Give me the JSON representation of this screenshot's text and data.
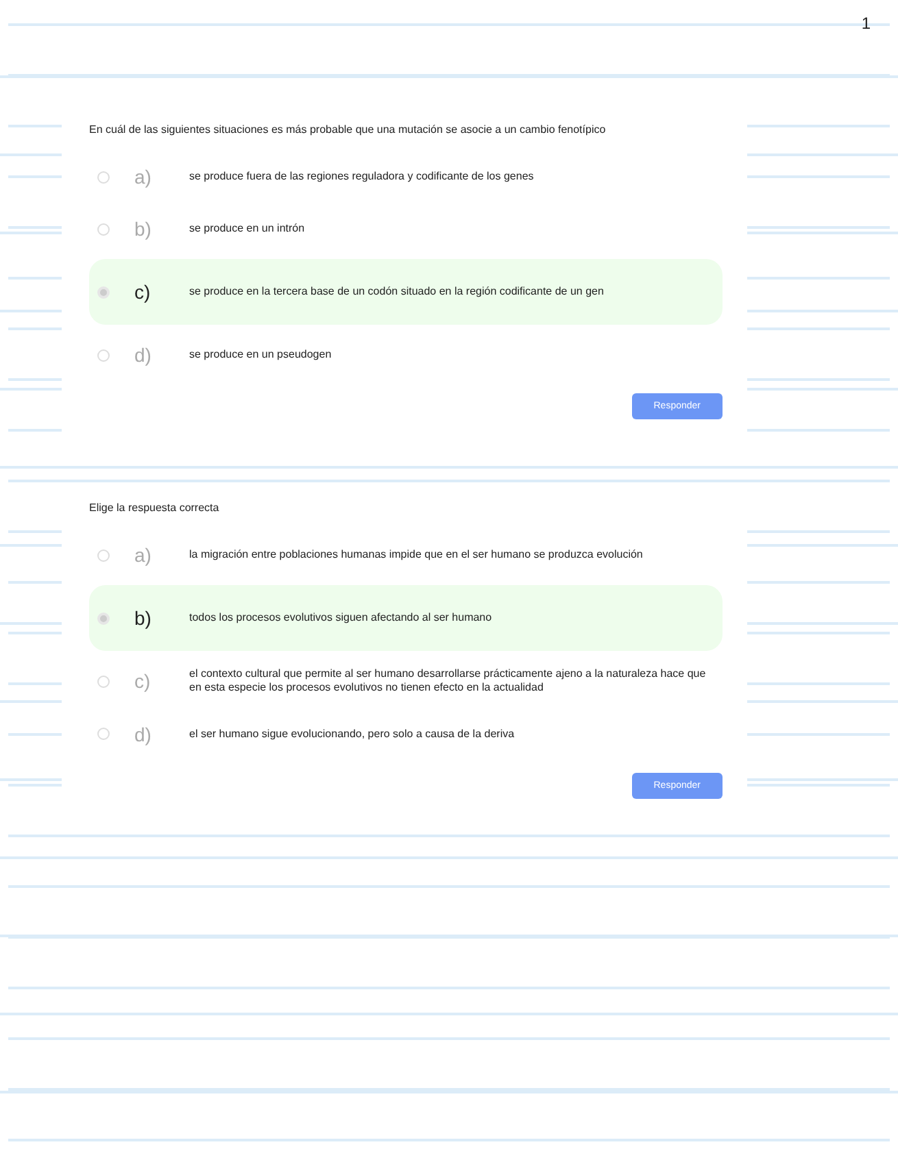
{
  "page_number": "1",
  "questions": [
    {
      "prompt": "En cuál de las siguientes situaciones es más probable que una mutación se asocie a un cambio fenotípico",
      "options": [
        {
          "letter": "a)",
          "text": "se produce fuera de las regiones reguladora y codificante de los genes",
          "selected": false
        },
        {
          "letter": "b)",
          "text": "se produce en un intrón",
          "selected": false
        },
        {
          "letter": "c)",
          "text": "se produce en la tercera base de un codón situado en la región codificante de un gen",
          "selected": true
        },
        {
          "letter": "d)",
          "text": "se produce en un pseudogen",
          "selected": false
        }
      ],
      "button": "Responder"
    },
    {
      "prompt": "Elige la respuesta correcta",
      "options": [
        {
          "letter": "a)",
          "text": "la migración entre poblaciones humanas impide que en el ser humano se produzca evolución",
          "selected": false
        },
        {
          "letter": "b)",
          "text": "todos los procesos evolutivos siguen afectando al ser humano",
          "selected": true
        },
        {
          "letter": "c)",
          "text": "el contexto cultural que permite al ser humano desarrollarse prácticamente ajeno a la naturaleza hace que en esta especie los procesos evolutivos no tienen efecto en la actualidad",
          "selected": false
        },
        {
          "letter": "d)",
          "text": "el ser humano sigue evolucionando, pero solo a causa de la deriva",
          "selected": false
        }
      ],
      "button": "Responder"
    }
  ]
}
